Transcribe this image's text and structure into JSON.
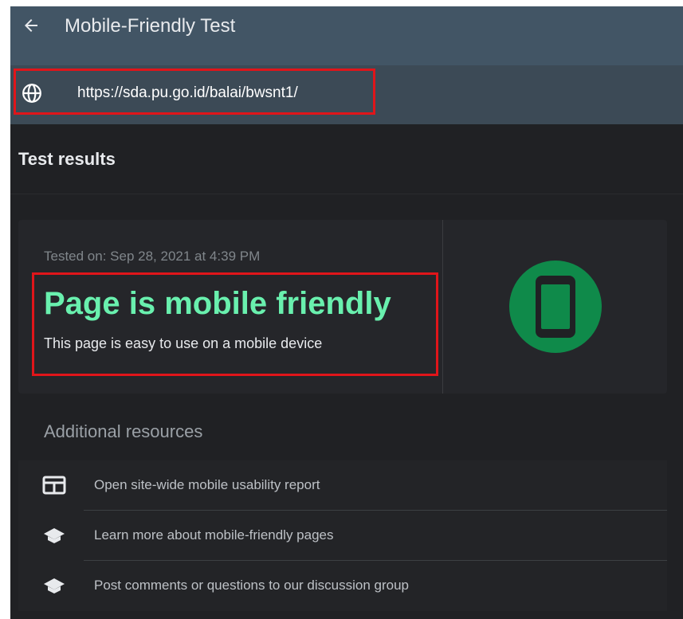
{
  "header": {
    "title": "Mobile-Friendly Test"
  },
  "url_bar": {
    "url": "https://sda.pu.go.id/balai/bwsnt1/"
  },
  "results": {
    "section_title": "Test results",
    "tested_on": "Tested on: Sep 28, 2021 at 4:39 PM",
    "verdict": "Page is mobile friendly",
    "verdict_description": "This page is easy to use on a mobile device",
    "verdict_color": "#69f0ae",
    "badge_color": "#0f8a4a"
  },
  "resources": {
    "title": "Additional resources",
    "items": [
      {
        "icon": "report-icon",
        "label": "Open site-wide mobile usability report"
      },
      {
        "icon": "school-icon",
        "label": "Learn more about mobile-friendly pages"
      },
      {
        "icon": "school-icon",
        "label": "Post comments or questions to our discussion group"
      }
    ]
  },
  "colors": {
    "highlight": "#e0151a",
    "topbar": "#425565",
    "urlbar": "#3c4a56"
  }
}
